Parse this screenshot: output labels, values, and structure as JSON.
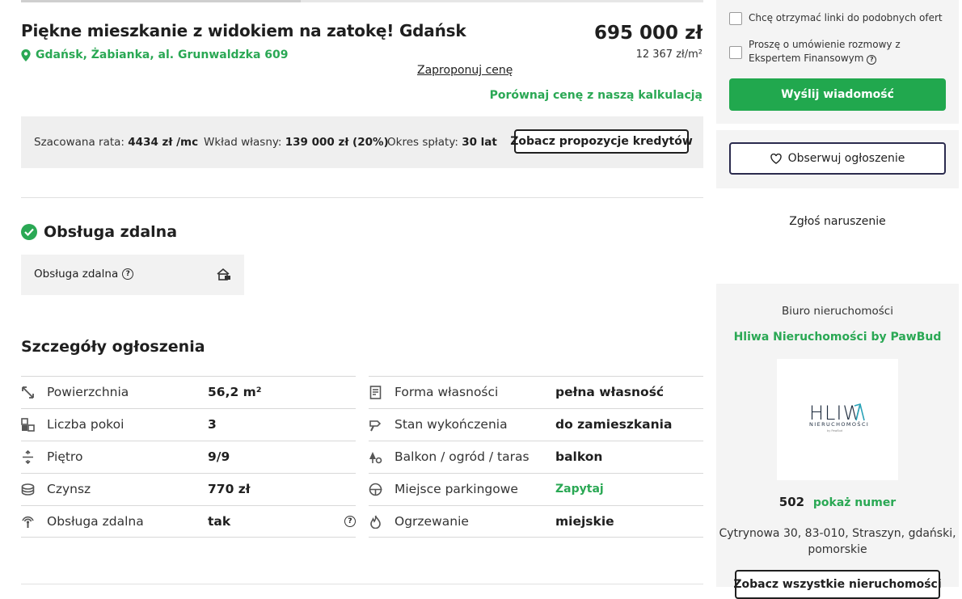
{
  "listing": {
    "title": "Piękne mieszkanie z widokiem na zatokę! Gdańsk",
    "location": "Gdańsk, Żabianka, al. Grunwaldzka 609",
    "price": "695 000 zł",
    "price_per_m2": "12 367 zł/m²",
    "propose_price": "Zaproponuj cenę",
    "compare_price": "Porównaj cenę z naszą kalkulacją"
  },
  "credit": {
    "rate_label": "Szacowana rata:",
    "rate_value": "4434 zł /mc",
    "deposit_label": "Wkład własny:",
    "deposit_value": "139 000 zł (20%)",
    "period_label": "Okres spłaty:",
    "period_value": "30 lat",
    "button": "Zobacz propozycje kredytów"
  },
  "remote": {
    "heading": "Obsługa zdalna",
    "box_label": "Obsługa zdalna",
    "help": "?"
  },
  "details": {
    "heading": "Szczegóły ogłoszenia",
    "left": [
      {
        "icon": "area-icon",
        "key": "Powierzchnia",
        "value": "56,2 m²"
      },
      {
        "icon": "rooms-icon",
        "key": "Liczba pokoi",
        "value": "3"
      },
      {
        "icon": "floor-icon",
        "key": "Piętro",
        "value": "9/9"
      },
      {
        "icon": "rent-icon",
        "key": "Czynsz",
        "value": "770 zł"
      },
      {
        "icon": "remote-service-icon",
        "key": "Obsługa zdalna",
        "value": "tak"
      }
    ],
    "right": [
      {
        "icon": "document-icon",
        "key": "Forma własności",
        "value": "pełna własność"
      },
      {
        "icon": "finish-icon",
        "key": "Stan wykończenia",
        "value": "do zamieszkania"
      },
      {
        "icon": "balcony-icon",
        "key": "Balkon / ogród / taras",
        "value": "balkon"
      },
      {
        "icon": "parking-icon",
        "key": "Miejsce parkingowe",
        "value": "Zapytaj"
      },
      {
        "icon": "heating-icon",
        "key": "Ogrzewanie",
        "value": "miejskie"
      }
    ]
  },
  "sidebar": {
    "similar_offers": "Chcę otrzymać linki do podobnych ofert",
    "expert_call": "Proszę o umówienie rozmowy z Ekspertem Finansowym",
    "send_button": "Wyślij wiadomość",
    "observe_button": "Obserwuj ogłoszenie",
    "report": "Zgłoś naruszenie",
    "agency_label": "Biuro nieruchomości",
    "agency_name": "Hliwa Nieruchomości by PawBud",
    "logo_text": "HLIWA",
    "logo_sub": "NIERUCHOMOŚCI",
    "phone_prefix": "502",
    "show_number": "pokaż numer",
    "address": "Cytrynowa 30, 83-010, Straszyn, gdański, pomorskie",
    "all_listings_button": "Zobacz wszystkie nieruchomości"
  },
  "colors": {
    "accent_green": "#2aa854",
    "button_green": "#21a84e",
    "text_dark": "#1f1f1f"
  }
}
